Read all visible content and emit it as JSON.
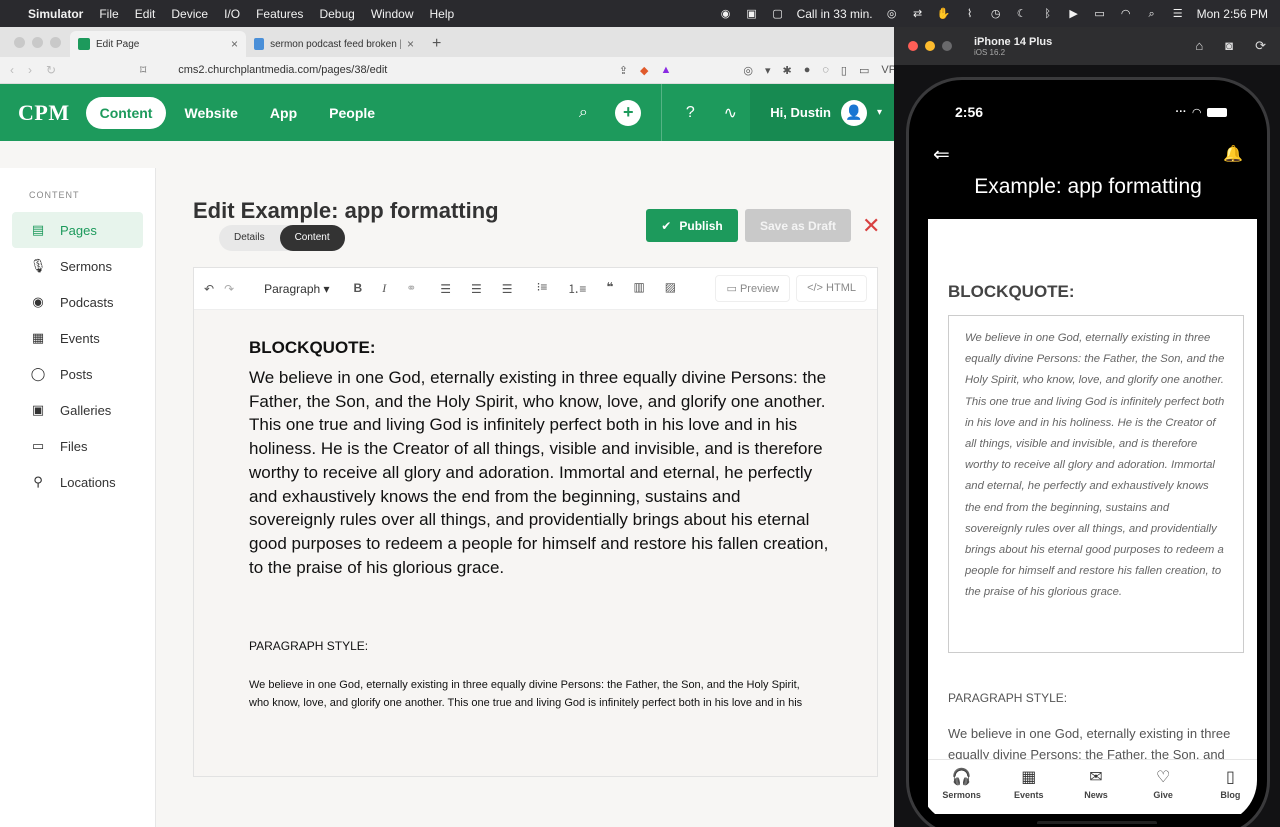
{
  "menubar": {
    "app": "Simulator",
    "items": [
      "File",
      "Edit",
      "Device",
      "I/O",
      "Features",
      "Debug",
      "Window",
      "Help"
    ],
    "call": "Call in 33 min.",
    "clock": "Mon  2:56 PM"
  },
  "browser": {
    "tabs": [
      {
        "title": "Edit Page",
        "fav_color": "#1d9a5c"
      },
      {
        "title": "sermon podcast feed broken | Shor",
        "fav_color": "#4a8fd8"
      }
    ],
    "url": "cms2.churchplantmedia.com/pages/38/edit",
    "vpn": "VPN"
  },
  "cms": {
    "logo": "CPM",
    "nav": [
      "Content",
      "Website",
      "App",
      "People"
    ],
    "user": "Hi, Dustin",
    "sidebar_section": "CONTENT",
    "sidebar": [
      {
        "label": "Pages",
        "icon": "pages-icon",
        "glyph": "▤"
      },
      {
        "label": "Sermons",
        "icon": "microphone-icon",
        "glyph": "🎙"
      },
      {
        "label": "Podcasts",
        "icon": "podcast-icon",
        "glyph": "◉"
      },
      {
        "label": "Events",
        "icon": "calendar-icon",
        "glyph": "▦"
      },
      {
        "label": "Posts",
        "icon": "speech-bubble-icon",
        "glyph": "◯"
      },
      {
        "label": "Galleries",
        "icon": "gallery-icon",
        "glyph": "▣"
      },
      {
        "label": "Files",
        "icon": "files-icon",
        "glyph": "▭"
      },
      {
        "label": "Locations",
        "icon": "location-pin-icon",
        "glyph": "⚲"
      }
    ],
    "page_title": "Edit Example: app formatting",
    "subtabs": [
      "Details",
      "Content"
    ],
    "publish": "Publish",
    "save_draft": "Save as Draft",
    "toolbar": {
      "paragraph": "Paragraph",
      "preview": "Preview",
      "html": "HTML"
    },
    "editor": {
      "bq_heading": "BLOCKQUOTE:",
      "bq_text": "We believe in one God, eternally existing in three equally divine Persons: the Father, the Son, and the Holy Spirit, who know, love, and glorify one another. This one true and living God is infinitely perfect both in his love and in his holiness. He is the Creator of all things, visible and invisible, and is therefore worthy to receive all glory and adoration. Immortal and eternal, he perfectly and exhaustively knows the end from the beginning, sustains and sovereignly rules over all things, and providentially brings about his eternal good purposes to redeem a people for himself and restore his fallen creation, to the praise of his glorious grace.",
      "para_heading": "PARAGRAPH STYLE:",
      "para_text": "We believe in one God, eternally existing in three equally divine Persons: the Father, the Son, and the Holy Spirit, who know, love, and glorify one another. This one true and living God is infinitely perfect both in his love and in his"
    }
  },
  "simulator": {
    "device": "iPhone 14 Plus",
    "os": "iOS 16.2",
    "time": "2:56",
    "app_title": "Example: app formatting",
    "bq_heading": "BLOCKQUOTE:",
    "bq_text": "We believe in one God, eternally existing in three equally divine Persons: the Father, the Son, and the Holy Spirit, who know, love, and glorify one another. This one true and living God is infinitely perfect both in his love and in his holiness. He is the Creator of all things, visible and invisible, and is therefore worthy to receive all glory and adoration. Immortal and eternal, he perfectly and exhaustively knows the end from the beginning, sustains and sovereignly rules over all things, and providentially brings about his eternal good purposes to redeem a people for himself and restore his fallen creation, to the praise of his glorious grace.",
    "para_heading": "PARAGRAPH STYLE:",
    "para_text": "We believe in one God, eternally existing in three equally divine Persons: the Father, the Son, and the",
    "tabs": [
      {
        "label": "Sermons",
        "glyph": "🎧"
      },
      {
        "label": "Events",
        "glyph": "▦"
      },
      {
        "label": "News",
        "glyph": "✉"
      },
      {
        "label": "Give",
        "glyph": "♡"
      },
      {
        "label": "Blog",
        "glyph": "▯"
      }
    ]
  }
}
